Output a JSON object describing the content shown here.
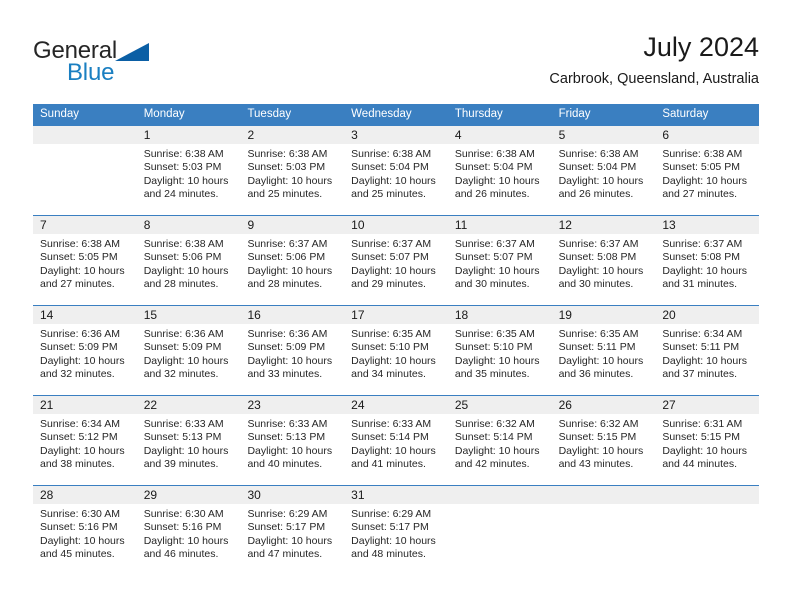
{
  "brand": {
    "name_part1": "General",
    "name_part2": "Blue",
    "triangle_icon": "blue-triangle-icon",
    "color_dark": "#262626",
    "color_blue": "#1a7fc1"
  },
  "header": {
    "title": "July 2024",
    "subtitle": "Carbrook, Queensland, Australia"
  },
  "theme": {
    "header_blue": "#3a7fc1",
    "day_strip_gray": "#efefef",
    "text": "#262626"
  },
  "weekdays": [
    "Sunday",
    "Monday",
    "Tuesday",
    "Wednesday",
    "Thursday",
    "Friday",
    "Saturday"
  ],
  "weeks": [
    {
      "days": [
        {
          "num": "",
          "sunrise": "",
          "sunset": "",
          "daylight1": "",
          "daylight2": ""
        },
        {
          "num": "1",
          "sunrise": "Sunrise: 6:38 AM",
          "sunset": "Sunset: 5:03 PM",
          "daylight1": "Daylight: 10 hours",
          "daylight2": "and 24 minutes."
        },
        {
          "num": "2",
          "sunrise": "Sunrise: 6:38 AM",
          "sunset": "Sunset: 5:03 PM",
          "daylight1": "Daylight: 10 hours",
          "daylight2": "and 25 minutes."
        },
        {
          "num": "3",
          "sunrise": "Sunrise: 6:38 AM",
          "sunset": "Sunset: 5:04 PM",
          "daylight1": "Daylight: 10 hours",
          "daylight2": "and 25 minutes."
        },
        {
          "num": "4",
          "sunrise": "Sunrise: 6:38 AM",
          "sunset": "Sunset: 5:04 PM",
          "daylight1": "Daylight: 10 hours",
          "daylight2": "and 26 minutes."
        },
        {
          "num": "5",
          "sunrise": "Sunrise: 6:38 AM",
          "sunset": "Sunset: 5:04 PM",
          "daylight1": "Daylight: 10 hours",
          "daylight2": "and 26 minutes."
        },
        {
          "num": "6",
          "sunrise": "Sunrise: 6:38 AM",
          "sunset": "Sunset: 5:05 PM",
          "daylight1": "Daylight: 10 hours",
          "daylight2": "and 27 minutes."
        }
      ]
    },
    {
      "days": [
        {
          "num": "7",
          "sunrise": "Sunrise: 6:38 AM",
          "sunset": "Sunset: 5:05 PM",
          "daylight1": "Daylight: 10 hours",
          "daylight2": "and 27 minutes."
        },
        {
          "num": "8",
          "sunrise": "Sunrise: 6:38 AM",
          "sunset": "Sunset: 5:06 PM",
          "daylight1": "Daylight: 10 hours",
          "daylight2": "and 28 minutes."
        },
        {
          "num": "9",
          "sunrise": "Sunrise: 6:37 AM",
          "sunset": "Sunset: 5:06 PM",
          "daylight1": "Daylight: 10 hours",
          "daylight2": "and 28 minutes."
        },
        {
          "num": "10",
          "sunrise": "Sunrise: 6:37 AM",
          "sunset": "Sunset: 5:07 PM",
          "daylight1": "Daylight: 10 hours",
          "daylight2": "and 29 minutes."
        },
        {
          "num": "11",
          "sunrise": "Sunrise: 6:37 AM",
          "sunset": "Sunset: 5:07 PM",
          "daylight1": "Daylight: 10 hours",
          "daylight2": "and 30 minutes."
        },
        {
          "num": "12",
          "sunrise": "Sunrise: 6:37 AM",
          "sunset": "Sunset: 5:08 PM",
          "daylight1": "Daylight: 10 hours",
          "daylight2": "and 30 minutes."
        },
        {
          "num": "13",
          "sunrise": "Sunrise: 6:37 AM",
          "sunset": "Sunset: 5:08 PM",
          "daylight1": "Daylight: 10 hours",
          "daylight2": "and 31 minutes."
        }
      ]
    },
    {
      "days": [
        {
          "num": "14",
          "sunrise": "Sunrise: 6:36 AM",
          "sunset": "Sunset: 5:09 PM",
          "daylight1": "Daylight: 10 hours",
          "daylight2": "and 32 minutes."
        },
        {
          "num": "15",
          "sunrise": "Sunrise: 6:36 AM",
          "sunset": "Sunset: 5:09 PM",
          "daylight1": "Daylight: 10 hours",
          "daylight2": "and 32 minutes."
        },
        {
          "num": "16",
          "sunrise": "Sunrise: 6:36 AM",
          "sunset": "Sunset: 5:09 PM",
          "daylight1": "Daylight: 10 hours",
          "daylight2": "and 33 minutes."
        },
        {
          "num": "17",
          "sunrise": "Sunrise: 6:35 AM",
          "sunset": "Sunset: 5:10 PM",
          "daylight1": "Daylight: 10 hours",
          "daylight2": "and 34 minutes."
        },
        {
          "num": "18",
          "sunrise": "Sunrise: 6:35 AM",
          "sunset": "Sunset: 5:10 PM",
          "daylight1": "Daylight: 10 hours",
          "daylight2": "and 35 minutes."
        },
        {
          "num": "19",
          "sunrise": "Sunrise: 6:35 AM",
          "sunset": "Sunset: 5:11 PM",
          "daylight1": "Daylight: 10 hours",
          "daylight2": "and 36 minutes."
        },
        {
          "num": "20",
          "sunrise": "Sunrise: 6:34 AM",
          "sunset": "Sunset: 5:11 PM",
          "daylight1": "Daylight: 10 hours",
          "daylight2": "and 37 minutes."
        }
      ]
    },
    {
      "days": [
        {
          "num": "21",
          "sunrise": "Sunrise: 6:34 AM",
          "sunset": "Sunset: 5:12 PM",
          "daylight1": "Daylight: 10 hours",
          "daylight2": "and 38 minutes."
        },
        {
          "num": "22",
          "sunrise": "Sunrise: 6:33 AM",
          "sunset": "Sunset: 5:13 PM",
          "daylight1": "Daylight: 10 hours",
          "daylight2": "and 39 minutes."
        },
        {
          "num": "23",
          "sunrise": "Sunrise: 6:33 AM",
          "sunset": "Sunset: 5:13 PM",
          "daylight1": "Daylight: 10 hours",
          "daylight2": "and 40 minutes."
        },
        {
          "num": "24",
          "sunrise": "Sunrise: 6:33 AM",
          "sunset": "Sunset: 5:14 PM",
          "daylight1": "Daylight: 10 hours",
          "daylight2": "and 41 minutes."
        },
        {
          "num": "25",
          "sunrise": "Sunrise: 6:32 AM",
          "sunset": "Sunset: 5:14 PM",
          "daylight1": "Daylight: 10 hours",
          "daylight2": "and 42 minutes."
        },
        {
          "num": "26",
          "sunrise": "Sunrise: 6:32 AM",
          "sunset": "Sunset: 5:15 PM",
          "daylight1": "Daylight: 10 hours",
          "daylight2": "and 43 minutes."
        },
        {
          "num": "27",
          "sunrise": "Sunrise: 6:31 AM",
          "sunset": "Sunset: 5:15 PM",
          "daylight1": "Daylight: 10 hours",
          "daylight2": "and 44 minutes."
        }
      ]
    },
    {
      "days": [
        {
          "num": "28",
          "sunrise": "Sunrise: 6:30 AM",
          "sunset": "Sunset: 5:16 PM",
          "daylight1": "Daylight: 10 hours",
          "daylight2": "and 45 minutes."
        },
        {
          "num": "29",
          "sunrise": "Sunrise: 6:30 AM",
          "sunset": "Sunset: 5:16 PM",
          "daylight1": "Daylight: 10 hours",
          "daylight2": "and 46 minutes."
        },
        {
          "num": "30",
          "sunrise": "Sunrise: 6:29 AM",
          "sunset": "Sunset: 5:17 PM",
          "daylight1": "Daylight: 10 hours",
          "daylight2": "and 47 minutes."
        },
        {
          "num": "31",
          "sunrise": "Sunrise: 6:29 AM",
          "sunset": "Sunset: 5:17 PM",
          "daylight1": "Daylight: 10 hours",
          "daylight2": "and 48 minutes."
        },
        {
          "num": "",
          "sunrise": "",
          "sunset": "",
          "daylight1": "",
          "daylight2": ""
        },
        {
          "num": "",
          "sunrise": "",
          "sunset": "",
          "daylight1": "",
          "daylight2": ""
        },
        {
          "num": "",
          "sunrise": "",
          "sunset": "",
          "daylight1": "",
          "daylight2": ""
        }
      ]
    }
  ]
}
